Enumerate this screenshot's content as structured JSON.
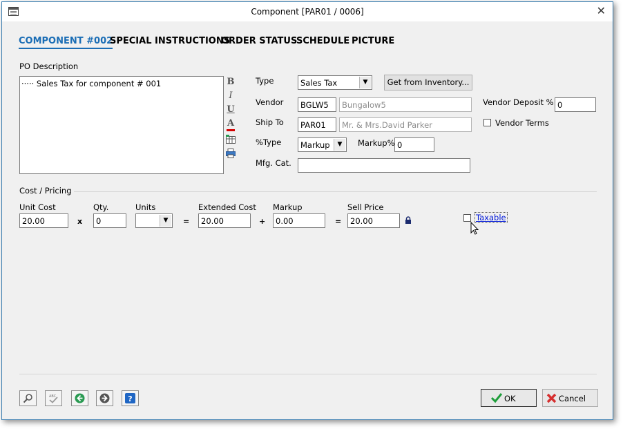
{
  "window": {
    "title": "Component [PAR01 / 0006]",
    "close_glyph": "✕"
  },
  "tabs": [
    "COMPONENT #002",
    "SPECIAL INSTRUCTIONS",
    "ORDER STATUS",
    "SCHEDULE",
    "PICTURE"
  ],
  "description": {
    "label": "PO Description",
    "text": "····· Sales Tax for component # 001"
  },
  "format_toolbar": {
    "bold": "B",
    "italic": "I",
    "underline": "U",
    "color": "A",
    "color_bar": "#d40000"
  },
  "type": {
    "label": "Type",
    "value": "Sales Tax",
    "inventory_button": "Get from Inventory..."
  },
  "vendor": {
    "label": "Vendor",
    "code": "BGLW5",
    "name": "Bungalow5",
    "deposit_label": "Vendor Deposit %",
    "deposit_value": "0",
    "terms_label": "Vendor Terms"
  },
  "ship_to": {
    "label": "Ship To",
    "code": "PAR01",
    "name": "Mr. & Mrs.David Parker"
  },
  "pct_type": {
    "label": "%Type",
    "value": "Markup",
    "markup_label": "Markup%",
    "markup_value": "0"
  },
  "mfg_cat": {
    "label": "Mfg. Cat.",
    "value": ""
  },
  "pricing": {
    "section_label": "Cost / Pricing",
    "unit_cost_label": "Unit Cost",
    "unit_cost": "20.00",
    "qty_label": "Qty.",
    "qty": "0",
    "units_label": "Units",
    "units": "",
    "extended_label": "Extended Cost",
    "extended": "20.00",
    "markup_label": "Markup",
    "markup": "0.00",
    "sell_label": "Sell Price",
    "sell": "20.00",
    "op_times": "x",
    "op_eq": "=",
    "op_plus": "+",
    "taxable_label": "Taxable"
  },
  "footer": {
    "ok_label": "OK",
    "cancel_label": "Cancel"
  },
  "colors": {
    "accent": "#1a6db5",
    "ok_check": "#1e9e3a",
    "cancel_x": "#d62f2f",
    "help": "#1f66c4",
    "nav_green": "#2a9a52",
    "nav_gray": "#555555"
  }
}
